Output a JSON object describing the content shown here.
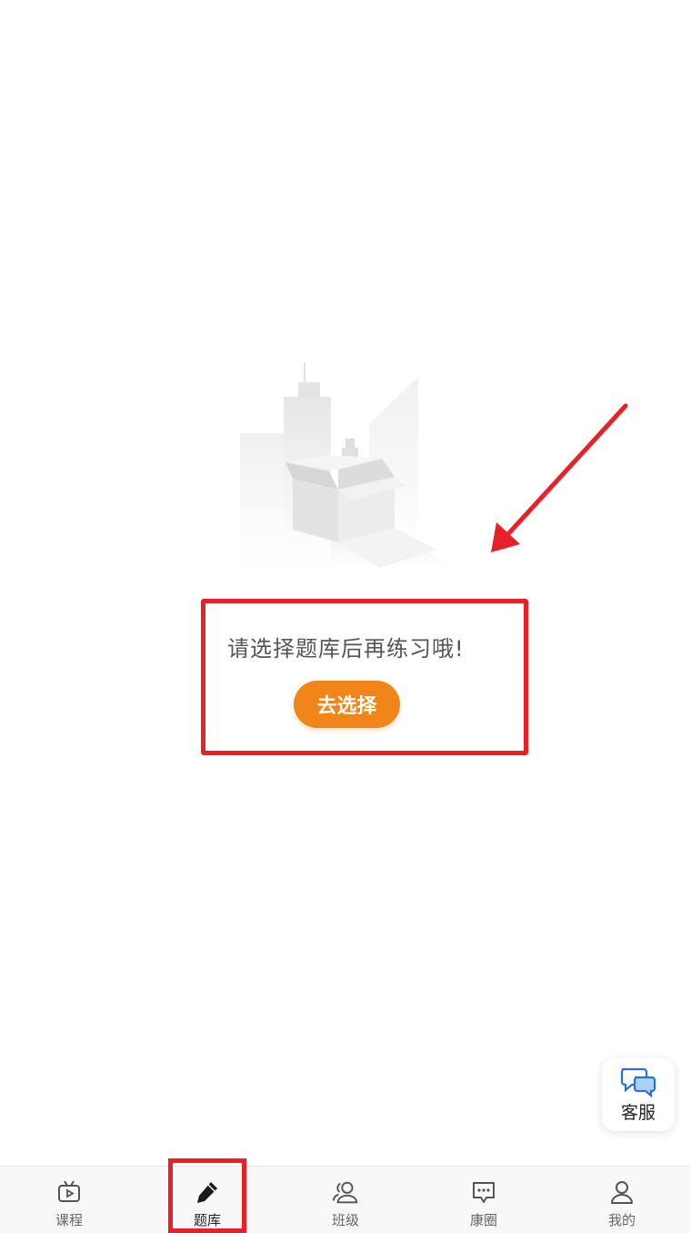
{
  "empty_state": {
    "message": "请选择题库后再练习哦!",
    "button_label": "去选择"
  },
  "floating": {
    "customer_service_label": "客服"
  },
  "tab_bar": {
    "active_index": 1,
    "items": [
      {
        "label": "课程",
        "icon": "tv-play-icon"
      },
      {
        "label": "题库",
        "icon": "pencil-icon"
      },
      {
        "label": "班级",
        "icon": "people-icon"
      },
      {
        "label": "康圈",
        "icon": "chat-bubble-icon"
      },
      {
        "label": "我的",
        "icon": "person-icon"
      }
    ]
  },
  "colors": {
    "accent": "#f08519",
    "annotation": "#e8202a",
    "tab_active": "#222222",
    "tab_inactive": "#666666"
  }
}
